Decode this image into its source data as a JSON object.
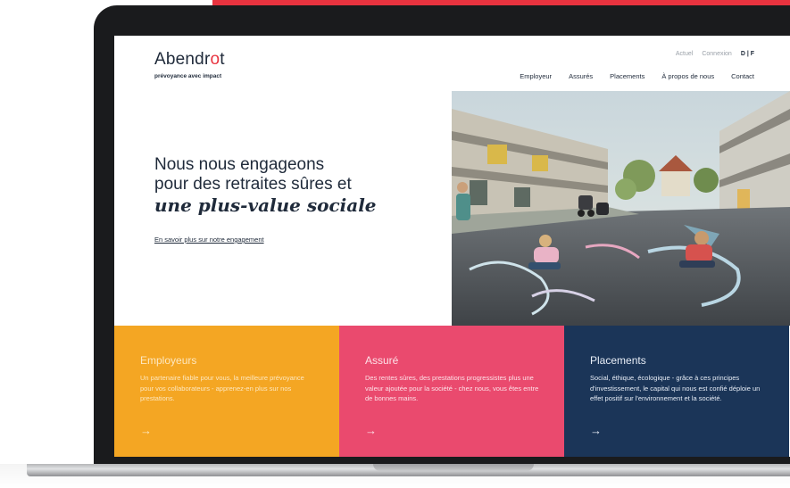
{
  "header": {
    "logo_before": "Abendr",
    "logo_mid": "o",
    "logo_after": "t",
    "tagline": "prévoyance avec impact",
    "topnav": {
      "actuel": "Actuel",
      "connexion": "Connexion",
      "lang": "D | F"
    },
    "mainnav": [
      "Employeur",
      "Assurés",
      "Placements",
      "À propos de nous",
      "Contact"
    ]
  },
  "hero": {
    "line1": "Nous nous engageons",
    "line2": "pour des retraites sûres et",
    "line3": "une plus-value sociale",
    "link": "En savoir plus sur notre engagement"
  },
  "cards": [
    {
      "title": "Employeurs",
      "text": "Un partenaire fiable pour vous, la meilleure prévoyance pour vos collaborateurs - apprenez-en plus sur nos prestations.",
      "arrow": "→"
    },
    {
      "title": "Assuré",
      "text": "Des rentes sûres, des prestations progressistes plus une valeur ajoutée pour la société - chez nous, vous êtes entre de bonnes mains.",
      "arrow": "→"
    },
    {
      "title": "Placements",
      "text": "Social, éthique, écologique - grâce à ces principes d'investissement, le capital qui nous est confié déploie un effet positif sur l'environnement et la société.",
      "arrow": "→"
    }
  ],
  "colors": {
    "brand_red": "#e8333f",
    "card_yellow": "#f4a623",
    "card_pink": "#ea4a6e",
    "card_navy": "#1b3558",
    "text_dark": "#1f2a3a"
  }
}
